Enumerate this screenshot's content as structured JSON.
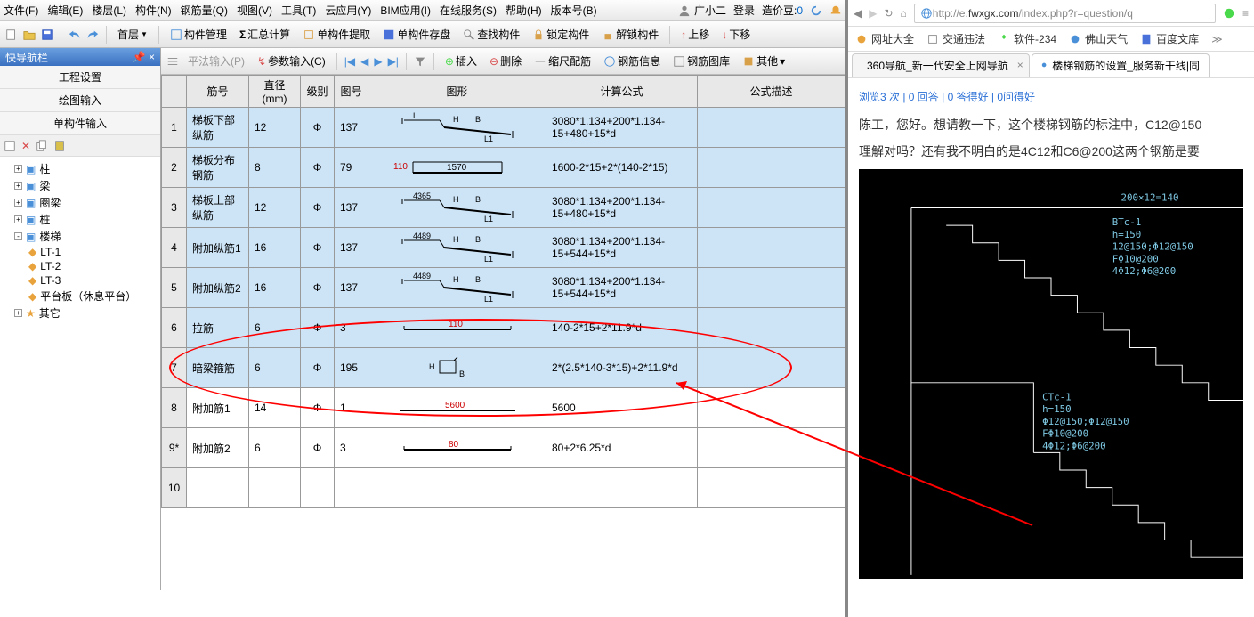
{
  "menu": {
    "items": [
      "文件(F)",
      "编辑(E)",
      "楼层(L)",
      "构件(N)",
      "钢筋量(Q)",
      "视图(V)",
      "工具(T)",
      "云应用(Y)",
      "BIM应用(I)",
      "在线服务(S)",
      "帮助(H)",
      "版本号(B)"
    ],
    "user": "广小二",
    "login": "登录",
    "priceLabel": "造价豆:",
    "priceValue": "0"
  },
  "toolbar1": {
    "floorLabel": "首层",
    "items": [
      "构件管理",
      "汇总计算",
      "单构件提取",
      "单构件存盘",
      "查找构件",
      "锁定构件",
      "解锁构件",
      "上移",
      "下移"
    ]
  },
  "navPanel": {
    "title": "快导航栏",
    "sections": [
      "工程设置",
      "绘图输入",
      "单构件输入"
    ]
  },
  "tree": {
    "items": [
      {
        "lvl": 1,
        "exp": "+",
        "label": "柱"
      },
      {
        "lvl": 1,
        "exp": "+",
        "label": "梁"
      },
      {
        "lvl": 1,
        "exp": "+",
        "label": "圈梁"
      },
      {
        "lvl": 1,
        "exp": "+",
        "label": "桩"
      },
      {
        "lvl": 1,
        "exp": "-",
        "label": "楼梯"
      },
      {
        "lvl": 2,
        "exp": "",
        "label": "LT-1"
      },
      {
        "lvl": 2,
        "exp": "",
        "label": "LT-2"
      },
      {
        "lvl": 2,
        "exp": "",
        "label": "LT-3"
      },
      {
        "lvl": 2,
        "exp": "",
        "label": "平台板（休息平台）"
      },
      {
        "lvl": 1,
        "exp": "+",
        "label": "其它"
      }
    ]
  },
  "subToolbar": {
    "items": [
      "平法输入(P)",
      "参数输入(C)"
    ],
    "items2": [
      "插入",
      "删除",
      "缩尺配筋",
      "钢筋信息",
      "钢筋图库",
      "其他"
    ]
  },
  "table": {
    "headers": [
      "",
      "筋号",
      "直径(mm)",
      "级别",
      "图号",
      "图形",
      "计算公式",
      "公式描述"
    ],
    "rows": [
      {
        "n": "1",
        "name": "梯板下部纵筋",
        "dia": "12",
        "lvl": "Φ",
        "fig": "137",
        "shape": "s1",
        "shapeLabels": {
          "a": "L",
          "b": "B",
          "c": "L1"
        },
        "formula": "3080*1.134+200*1.134-15+480+15*d",
        "desc": ""
      },
      {
        "n": "2",
        "name": "梯板分布钢筋",
        "dia": "8",
        "lvl": "Φ",
        "fig": "79",
        "shape": "s2",
        "shapeLabels": {
          "a": "110",
          "b": "1570"
        },
        "formula": "1600-2*15+2*(140-2*15)",
        "desc": ""
      },
      {
        "n": "3",
        "name": "梯板上部纵筋",
        "dia": "12",
        "lvl": "Φ",
        "fig": "137",
        "shape": "s1",
        "shapeLabels": {
          "a": "4365",
          "b": "B",
          "c": "L1"
        },
        "formula": "3080*1.134+200*1.134-15+480+15*d",
        "desc": ""
      },
      {
        "n": "4",
        "name": "附加纵筋1",
        "dia": "16",
        "lvl": "Φ",
        "fig": "137",
        "shape": "s1",
        "shapeLabels": {
          "a": "4489",
          "b": "B",
          "c": "L1"
        },
        "formula": "3080*1.134+200*1.134-15+544+15*d",
        "desc": ""
      },
      {
        "n": "5",
        "name": "附加纵筋2",
        "dia": "16",
        "lvl": "Φ",
        "fig": "137",
        "shape": "s1",
        "shapeLabels": {
          "a": "4489",
          "b": "B",
          "c": "L1"
        },
        "formula": "3080*1.134+200*1.134-15+544+15*d",
        "desc": ""
      },
      {
        "n": "6",
        "name": "拉筋",
        "dia": "6",
        "lvl": "Φ",
        "fig": "3",
        "shape": "s3",
        "shapeLabels": {
          "a": "110"
        },
        "formula": "140-2*15+2*11.9*d",
        "desc": ""
      },
      {
        "n": "7",
        "name": "暗梁箍筋",
        "dia": "6",
        "lvl": "Φ",
        "fig": "195",
        "shape": "s4",
        "shapeLabels": {
          "a": "H",
          "b": "B"
        },
        "formula": "2*(2.5*140-3*15)+2*11.9*d",
        "desc": ""
      },
      {
        "n": "8",
        "name": "附加筋1",
        "dia": "14",
        "lvl": "Φ",
        "fig": "1",
        "shape": "s5",
        "shapeLabels": {
          "a": "5600"
        },
        "formula": "5600",
        "desc": "",
        "white": true
      },
      {
        "n": "9*",
        "name": "附加筋2",
        "dia": "6",
        "lvl": "Φ",
        "fig": "3",
        "shape": "s3",
        "shapeLabels": {
          "a": "80"
        },
        "formula": "80+2*6.25*d",
        "desc": "",
        "white": true
      },
      {
        "n": "10",
        "name": "",
        "dia": "",
        "lvl": "",
        "fig": "",
        "shape": "",
        "formula": "",
        "desc": "",
        "white": true,
        "empty": true
      }
    ]
  },
  "browser": {
    "url_prefix": "http://e.",
    "url_domain": "fwxgx.com",
    "url_suffix": "/index.php?r=question/q",
    "bookmarks": [
      "网址大全",
      "交通违法",
      "软件-234",
      "佛山天气",
      "百度文库"
    ],
    "tabs": [
      {
        "label": "360导航_新一代安全上网导航",
        "active": false
      },
      {
        "label": "楼梯钢筋的设置_服务新干线|同",
        "active": true
      }
    ],
    "meta": "浏览3 次 | 0 回答 | 0 答得好 | 0问得好",
    "text1": "陈工，您好。想请教一下，这个楼梯钢筋的标注中，C12@150",
    "text2": "理解对吗？还有我不明白的是4C12和C6@200这两个钢筋是要",
    "cad": {
      "bt": {
        "title": "BTc-1",
        "h": "h=150",
        "l1": "12@150;Φ12@150",
        "l2": "FΦ10@200",
        "l3": "4Φ12;Φ6@200"
      },
      "ct": {
        "title": "CTc-1",
        "h": "h=150",
        "l1": "Φ12@150;Φ12@150",
        "l2": "FΦ10@200",
        "l3": "4Φ12;Φ6@200"
      },
      "dim": "200×12=140"
    }
  }
}
